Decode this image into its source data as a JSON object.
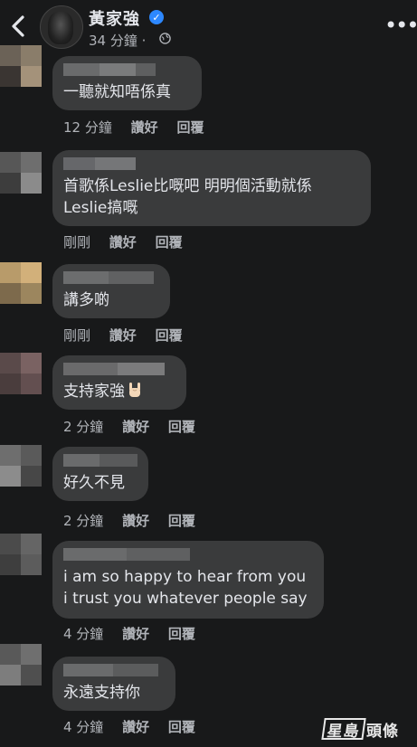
{
  "header": {
    "page_name": "黃家強",
    "time": "34 分鐘 ·",
    "colors": {
      "background": "#18191a",
      "bubble": "#3a3b3c",
      "verified": "#2d88ff",
      "muted": "#b0b3b8"
    }
  },
  "comments": [
    {
      "text": "一聽就知唔係真",
      "time": "12 分鐘",
      "like": "讚好",
      "reply": "回覆"
    },
    {
      "text": "首歌係Leslie比嘅吧 明明個活動就係\nLeslie搞嘅",
      "time": "剛剛",
      "like": "讚好",
      "reply": "回覆"
    },
    {
      "text": "講多啲",
      "time": "剛剛",
      "like": "讚好",
      "reply": "回覆"
    },
    {
      "text": "支持家強",
      "emoji": "rock-hand-emoji",
      "time": "2 分鐘",
      "like": "讚好",
      "reply": "回覆"
    },
    {
      "text": "好久不見",
      "time": "2 分鐘",
      "like": "讚好",
      "reply": "回覆"
    },
    {
      "text": "i am so happy to hear from you\ni trust you whatever people say",
      "time": "4 分鐘",
      "like": "讚好",
      "reply": "回覆"
    },
    {
      "text": "永遠支持你",
      "time": "4 分鐘",
      "like": "讚好",
      "reply": "回覆"
    }
  ],
  "watermark": {
    "boxed": "星島",
    "rest": "頭條"
  }
}
